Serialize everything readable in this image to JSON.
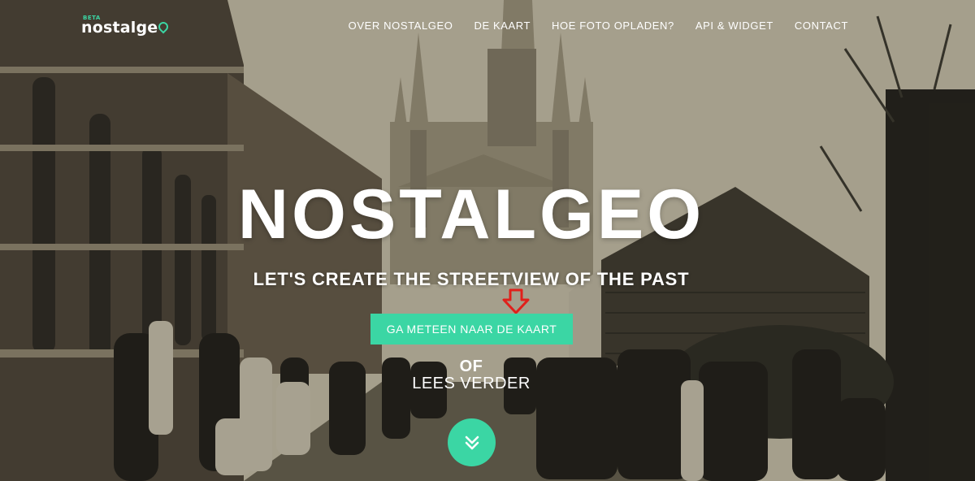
{
  "logo": {
    "beta": "BETA",
    "word": "nostalge",
    "pin_icon": "map-pin-icon",
    "accent": "#3bd6a4"
  },
  "nav": {
    "items": [
      {
        "label": "OVER NOSTALGEO"
      },
      {
        "label": "DE KAART"
      },
      {
        "label": "HOE FOTO OPLADEN?"
      },
      {
        "label": "API & WIDGET"
      },
      {
        "label": "CONTACT"
      }
    ]
  },
  "hero": {
    "title": "NOSTALGEO",
    "subtitle": "LET'S CREATE THE STREETVIEW OF THE PAST",
    "cta_label": "GA METEEN NAAR DE KAART",
    "or_label": "OF",
    "read_more_label": "LEES VERDER",
    "arrow_icon": "down-arrow-icon",
    "arrow_color": "#e0201b",
    "scroll_icon": "double-chevron-down-icon",
    "button_color": "#3bd6a4"
  }
}
